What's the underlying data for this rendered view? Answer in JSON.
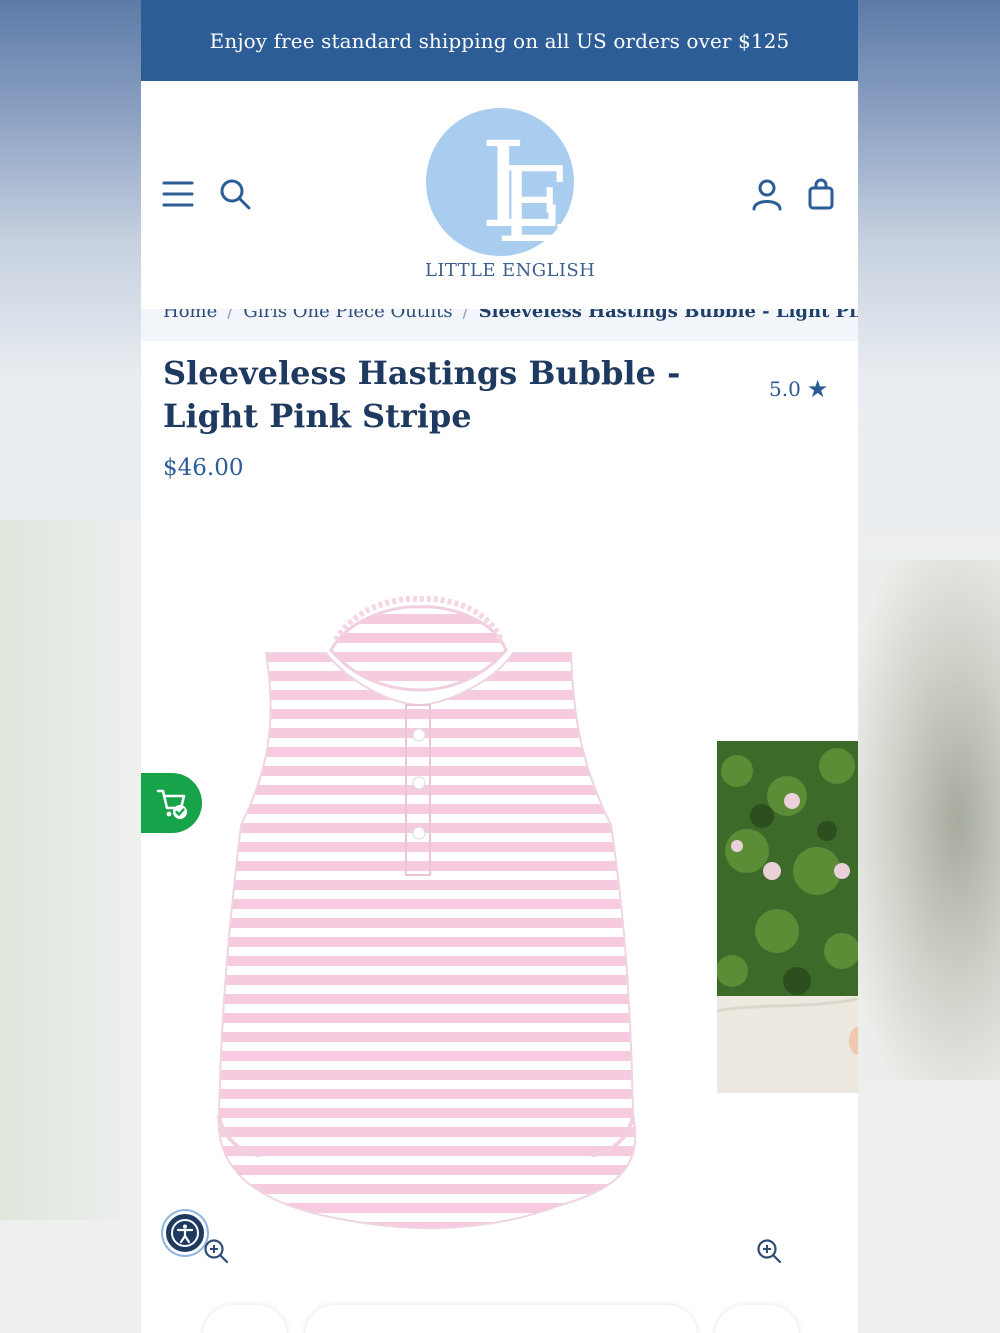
{
  "announcement": {
    "text": "Enjoy free standard shipping on all US orders over $125"
  },
  "header": {
    "logo_monogram": "LE",
    "logo_text": "LITTLE ENGLISH",
    "icons": [
      "menu-icon",
      "search-icon",
      "account-icon",
      "shopping-bag-icon"
    ]
  },
  "breadcrumb": {
    "items": [
      "Home",
      "Girls One Piece Outfits",
      "Sleeveless Hastings Bubble - Light Pink Stripe"
    ]
  },
  "product": {
    "title": "Sleeveless Hastings Bubble - Light Pink Stripe",
    "rating": "5.0",
    "price": "$46.00",
    "images": [
      "product-main-image",
      "product-lifestyle-image"
    ]
  },
  "colors": {
    "brand_blue": "#2c5d97",
    "logo_blue": "#a9cdef",
    "title_navy": "#1f3a60",
    "cart_green": "#16a34a",
    "stripe_pink": "#f6cbe0"
  }
}
